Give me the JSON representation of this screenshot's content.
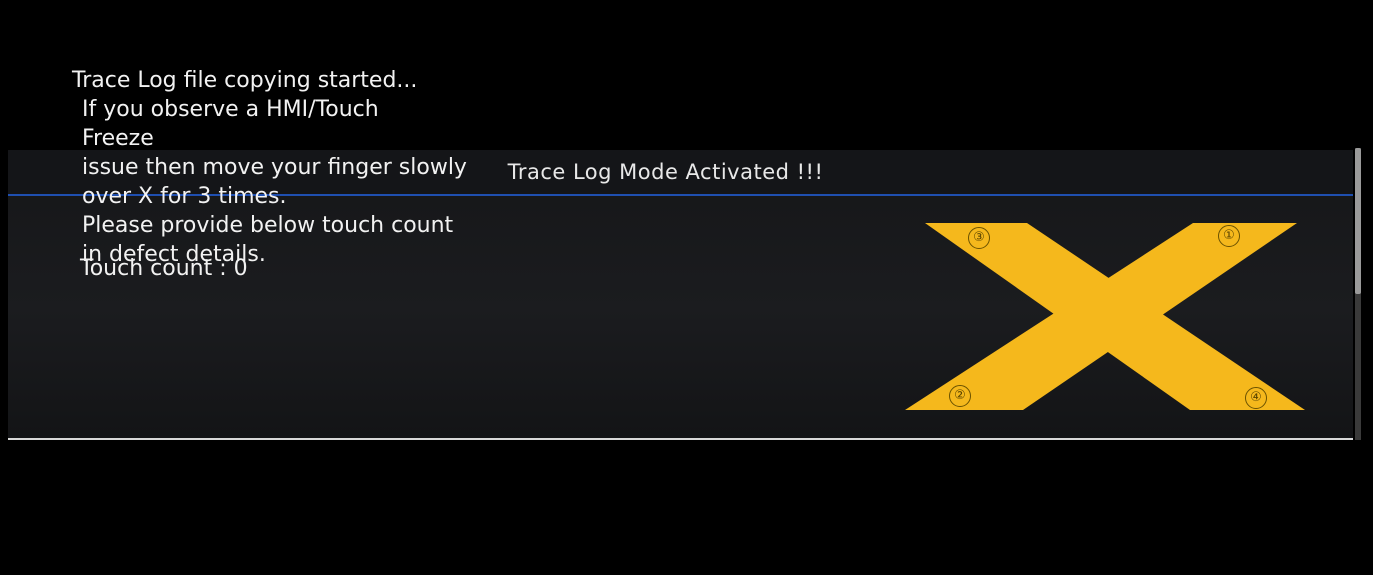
{
  "dialog": {
    "title": "Trace Log Mode Activated !!!",
    "message_lines": [
      "Trace Log file copying started...",
      "If you observe a HMI/Touch",
      "Freeze",
      "issue then move your finger slowly",
      "over X for 3 times.",
      "Please provide below touch count",
      "in defect details."
    ],
    "touch_count_label": "Touch count :",
    "touch_count_value": "0"
  },
  "x_pad": {
    "color": "#f5b81c",
    "markers": [
      "③",
      "①",
      "②",
      "④"
    ]
  }
}
